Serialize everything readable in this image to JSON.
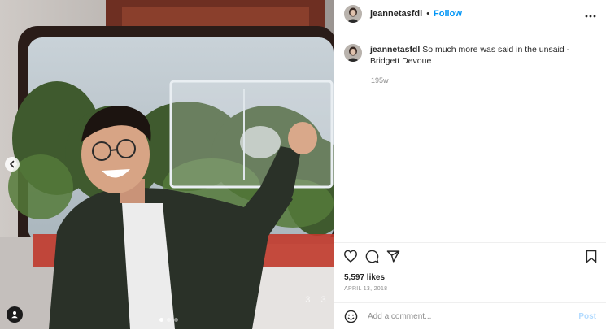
{
  "post": {
    "username": "jeannetasfdl",
    "separator": "•",
    "follow_label": "Follow",
    "more_icon": "more-horizontal-icon",
    "caption_text": "So much more was said in the unsaid - Bridgett Devoue",
    "time_ago": "195w",
    "likes": "5,597 likes",
    "date": "APRIL 13, 2018",
    "comment_placeholder": "Add a comment...",
    "post_label": "Post"
  },
  "media": {
    "film_stamp": "3 3",
    "carousel_dots": 3,
    "active_dot": 0
  },
  "colors": {
    "accent": "#0095f6",
    "text": "#262626",
    "muted": "#8e8e8e",
    "post_disabled": "#b3dbff"
  }
}
